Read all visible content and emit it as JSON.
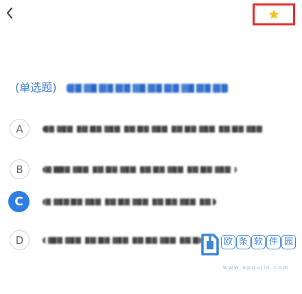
{
  "theme": {
    "accent": "#2f7fe2",
    "question_color": "#3d7dd6",
    "highlight_border": "#e32b2b",
    "star": "#f6c21c",
    "watermark": "#3a86d8",
    "watermark_url": "#8fb4e0"
  },
  "header": {
    "back_icon": "chevron-left-icon",
    "favorite_icon": "star-icon"
  },
  "question": {
    "type_label": "(单选题)"
  },
  "options": [
    {
      "letter": "A",
      "selected": false
    },
    {
      "letter": "B",
      "selected": false
    },
    {
      "letter": "C",
      "selected": true
    },
    {
      "letter": "D",
      "selected": false
    }
  ],
  "watermark": {
    "logo_icon": "download-box-icon",
    "name": "欧条软件园",
    "url": "www.apoujin.com"
  }
}
